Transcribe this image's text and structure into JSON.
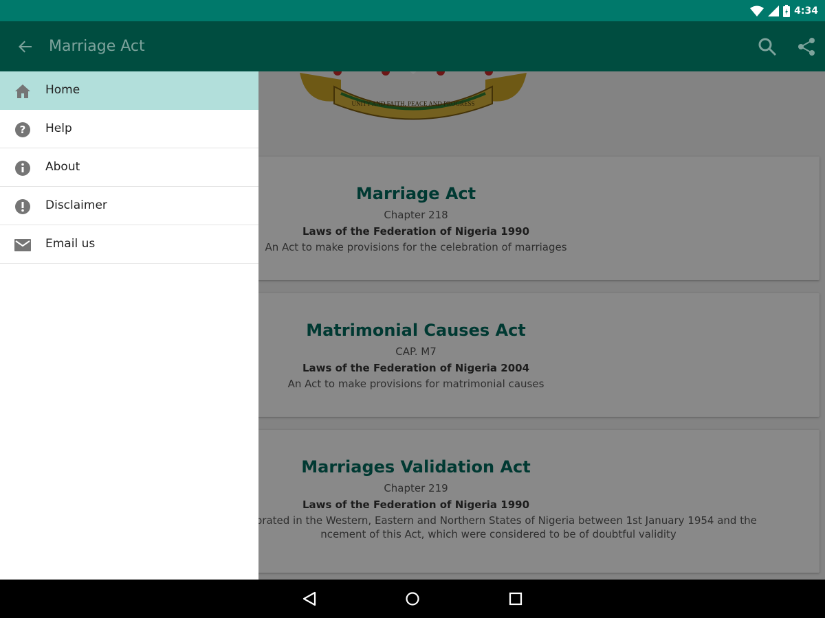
{
  "status_bar": {
    "time": "4:34"
  },
  "app_bar": {
    "title": "Marriage Act"
  },
  "drawer": {
    "items": [
      {
        "label": "Home",
        "icon": "home-icon",
        "active": true
      },
      {
        "label": "Help",
        "icon": "help-icon"
      },
      {
        "label": "About",
        "icon": "info-icon"
      },
      {
        "label": "Disclaimer",
        "icon": "alert-icon"
      },
      {
        "label": "Email us",
        "icon": "email-icon"
      }
    ]
  },
  "crest": {
    "motto": "UNITY AND FAITH, PEACE AND PROGRESS"
  },
  "cards": [
    {
      "title": "Marriage Act",
      "chapter": "Chapter 218",
      "laws": "Laws of the Federation of Nigeria 1990",
      "description": "An Act to make provisions for the celebration of marriages"
    },
    {
      "title": "Matrimonial Causes Act",
      "chapter": "CAP. M7",
      "laws": "Laws of the Federation of Nigeria 2004",
      "description": "An Act to make provisions for matrimonial causes"
    },
    {
      "title": "Marriages Validation Act",
      "chapter": "Chapter 219",
      "laws": "Laws of the Federation of Nigeria 1990",
      "description": "elebrated in the Western, Eastern and Northern States of Nigeria between 1st January 1954 and the ncement of this Act, which were considered to be of doubtful validity"
    }
  ],
  "colors": {
    "status_bar": "#00796b",
    "app_bar": "#004d40",
    "drawer_active": "#b2dfdb",
    "card_title": "#00695c"
  }
}
